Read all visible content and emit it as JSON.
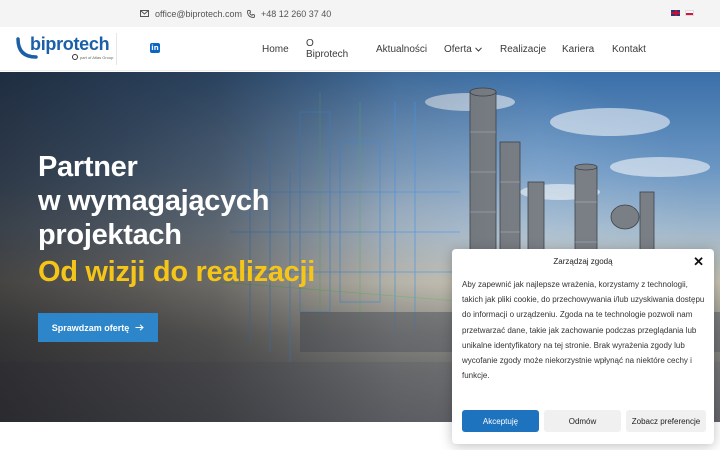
{
  "topbar": {
    "email": "office@biprotech.com",
    "phone": "+48 12 260 37 40",
    "languages": [
      "en",
      "pl"
    ]
  },
  "header": {
    "logo_text": "biprotech",
    "logo_subtext": "part of Atlas Group",
    "social": "in",
    "nav": [
      "Home",
      "O Biprotech",
      "Aktualności",
      "Oferta",
      "Realizacje",
      "Kariera",
      "Kontakt"
    ]
  },
  "hero": {
    "title_lines": [
      "Partner",
      "w wymagających",
      "projektach"
    ],
    "subtitle": "Od wizji do realizacji",
    "cta_label": "Sprawdzam ofertę"
  },
  "cookie": {
    "title": "Zarządzaj zgodą",
    "body": "Aby zapewnić jak najlepsze wrażenia, korzystamy z technologii, takich jak pliki cookie, do przechowywania i/lub uzyskiwania dostępu do informacji o urządzeniu. Zgoda na te technologie pozwoli nam przetwarzać dane, takie jak zachowanie podczas przeglądania lub unikalne identyfikatory na tej stronie. Brak wyrażenia zgody lub wycofanie zgody może niekorzystnie wpłynąć na niektóre cechy i funkcje.",
    "accept_label": "Akceptuję",
    "deny_label": "Odmów",
    "prefs_label": "Zobacz preferencje"
  },
  "colors": {
    "brand_blue": "#1b5fa8",
    "cta_blue": "#2d86c9",
    "accent_yellow": "#f5c518",
    "accept_blue": "#1e73be"
  }
}
